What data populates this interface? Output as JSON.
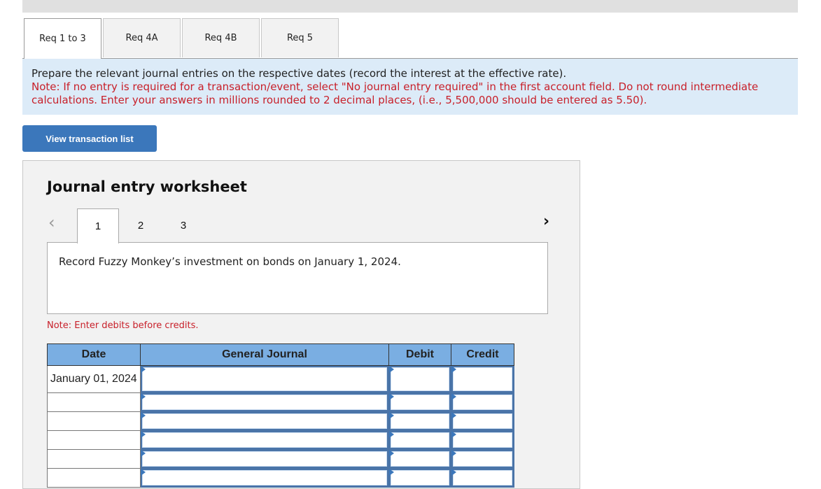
{
  "tabs": [
    {
      "label": "Req 1 to 3",
      "active": true
    },
    {
      "label": "Req 4A",
      "active": false
    },
    {
      "label": "Req 4B",
      "active": false
    },
    {
      "label": "Req 5",
      "active": false
    }
  ],
  "instructions": {
    "main": "Prepare the relevant journal entries on the respective dates (record the interest at the effective rate).",
    "note": "Note: If no entry is required for a transaction/event, select \"No journal entry required\" in the first account field. Do not round intermediate calculations. Enter your answers in millions rounded to 2 decimal places, (i.e., 5,500,000 should be entered as 5.50)."
  },
  "view_transaction_button": "View transaction list",
  "worksheet": {
    "title": "Journal entry worksheet",
    "prev_icon": "chevron-left-icon",
    "next_icon": "chevron-right-icon",
    "pages": [
      "1",
      "2",
      "3"
    ],
    "active_page": "1",
    "description": "Record Fuzzy Monkey’s investment on bonds on January 1, 2024.",
    "note": "Note: Enter debits before credits.",
    "table": {
      "headers": [
        "Date",
        "General Journal",
        "Debit",
        "Credit"
      ],
      "rows": [
        {
          "date": "January 01, 2024",
          "account": "",
          "debit": "",
          "credit": ""
        },
        {
          "date": "",
          "account": "",
          "debit": "",
          "credit": ""
        },
        {
          "date": "",
          "account": "",
          "debit": "",
          "credit": ""
        },
        {
          "date": "",
          "account": "",
          "debit": "",
          "credit": ""
        },
        {
          "date": "",
          "account": "",
          "debit": "",
          "credit": ""
        },
        {
          "date": "",
          "account": "",
          "debit": "",
          "credit": ""
        }
      ]
    }
  }
}
